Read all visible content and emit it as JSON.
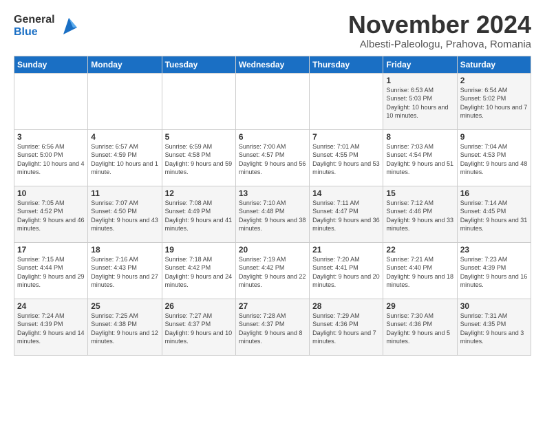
{
  "logo": {
    "line1": "General",
    "line2": "Blue"
  },
  "title": "November 2024",
  "subtitle": "Albesti-Paleologu, Prahova, Romania",
  "header_days": [
    "Sunday",
    "Monday",
    "Tuesday",
    "Wednesday",
    "Thursday",
    "Friday",
    "Saturday"
  ],
  "weeks": [
    [
      {
        "day": "",
        "info": ""
      },
      {
        "day": "",
        "info": ""
      },
      {
        "day": "",
        "info": ""
      },
      {
        "day": "",
        "info": ""
      },
      {
        "day": "",
        "info": ""
      },
      {
        "day": "1",
        "info": "Sunrise: 6:53 AM\nSunset: 5:03 PM\nDaylight: 10 hours and 10 minutes."
      },
      {
        "day": "2",
        "info": "Sunrise: 6:54 AM\nSunset: 5:02 PM\nDaylight: 10 hours and 7 minutes."
      }
    ],
    [
      {
        "day": "3",
        "info": "Sunrise: 6:56 AM\nSunset: 5:00 PM\nDaylight: 10 hours and 4 minutes."
      },
      {
        "day": "4",
        "info": "Sunrise: 6:57 AM\nSunset: 4:59 PM\nDaylight: 10 hours and 1 minute."
      },
      {
        "day": "5",
        "info": "Sunrise: 6:59 AM\nSunset: 4:58 PM\nDaylight: 9 hours and 59 minutes."
      },
      {
        "day": "6",
        "info": "Sunrise: 7:00 AM\nSunset: 4:57 PM\nDaylight: 9 hours and 56 minutes."
      },
      {
        "day": "7",
        "info": "Sunrise: 7:01 AM\nSunset: 4:55 PM\nDaylight: 9 hours and 53 minutes."
      },
      {
        "day": "8",
        "info": "Sunrise: 7:03 AM\nSunset: 4:54 PM\nDaylight: 9 hours and 51 minutes."
      },
      {
        "day": "9",
        "info": "Sunrise: 7:04 AM\nSunset: 4:53 PM\nDaylight: 9 hours and 48 minutes."
      }
    ],
    [
      {
        "day": "10",
        "info": "Sunrise: 7:05 AM\nSunset: 4:52 PM\nDaylight: 9 hours and 46 minutes."
      },
      {
        "day": "11",
        "info": "Sunrise: 7:07 AM\nSunset: 4:50 PM\nDaylight: 9 hours and 43 minutes."
      },
      {
        "day": "12",
        "info": "Sunrise: 7:08 AM\nSunset: 4:49 PM\nDaylight: 9 hours and 41 minutes."
      },
      {
        "day": "13",
        "info": "Sunrise: 7:10 AM\nSunset: 4:48 PM\nDaylight: 9 hours and 38 minutes."
      },
      {
        "day": "14",
        "info": "Sunrise: 7:11 AM\nSunset: 4:47 PM\nDaylight: 9 hours and 36 minutes."
      },
      {
        "day": "15",
        "info": "Sunrise: 7:12 AM\nSunset: 4:46 PM\nDaylight: 9 hours and 33 minutes."
      },
      {
        "day": "16",
        "info": "Sunrise: 7:14 AM\nSunset: 4:45 PM\nDaylight: 9 hours and 31 minutes."
      }
    ],
    [
      {
        "day": "17",
        "info": "Sunrise: 7:15 AM\nSunset: 4:44 PM\nDaylight: 9 hours and 29 minutes."
      },
      {
        "day": "18",
        "info": "Sunrise: 7:16 AM\nSunset: 4:43 PM\nDaylight: 9 hours and 27 minutes."
      },
      {
        "day": "19",
        "info": "Sunrise: 7:18 AM\nSunset: 4:42 PM\nDaylight: 9 hours and 24 minutes."
      },
      {
        "day": "20",
        "info": "Sunrise: 7:19 AM\nSunset: 4:42 PM\nDaylight: 9 hours and 22 minutes."
      },
      {
        "day": "21",
        "info": "Sunrise: 7:20 AM\nSunset: 4:41 PM\nDaylight: 9 hours and 20 minutes."
      },
      {
        "day": "22",
        "info": "Sunrise: 7:21 AM\nSunset: 4:40 PM\nDaylight: 9 hours and 18 minutes."
      },
      {
        "day": "23",
        "info": "Sunrise: 7:23 AM\nSunset: 4:39 PM\nDaylight: 9 hours and 16 minutes."
      }
    ],
    [
      {
        "day": "24",
        "info": "Sunrise: 7:24 AM\nSunset: 4:39 PM\nDaylight: 9 hours and 14 minutes."
      },
      {
        "day": "25",
        "info": "Sunrise: 7:25 AM\nSunset: 4:38 PM\nDaylight: 9 hours and 12 minutes."
      },
      {
        "day": "26",
        "info": "Sunrise: 7:27 AM\nSunset: 4:37 PM\nDaylight: 9 hours and 10 minutes."
      },
      {
        "day": "27",
        "info": "Sunrise: 7:28 AM\nSunset: 4:37 PM\nDaylight: 9 hours and 8 minutes."
      },
      {
        "day": "28",
        "info": "Sunrise: 7:29 AM\nSunset: 4:36 PM\nDaylight: 9 hours and 7 minutes."
      },
      {
        "day": "29",
        "info": "Sunrise: 7:30 AM\nSunset: 4:36 PM\nDaylight: 9 hours and 5 minutes."
      },
      {
        "day": "30",
        "info": "Sunrise: 7:31 AM\nSunset: 4:35 PM\nDaylight: 9 hours and 3 minutes."
      }
    ]
  ]
}
